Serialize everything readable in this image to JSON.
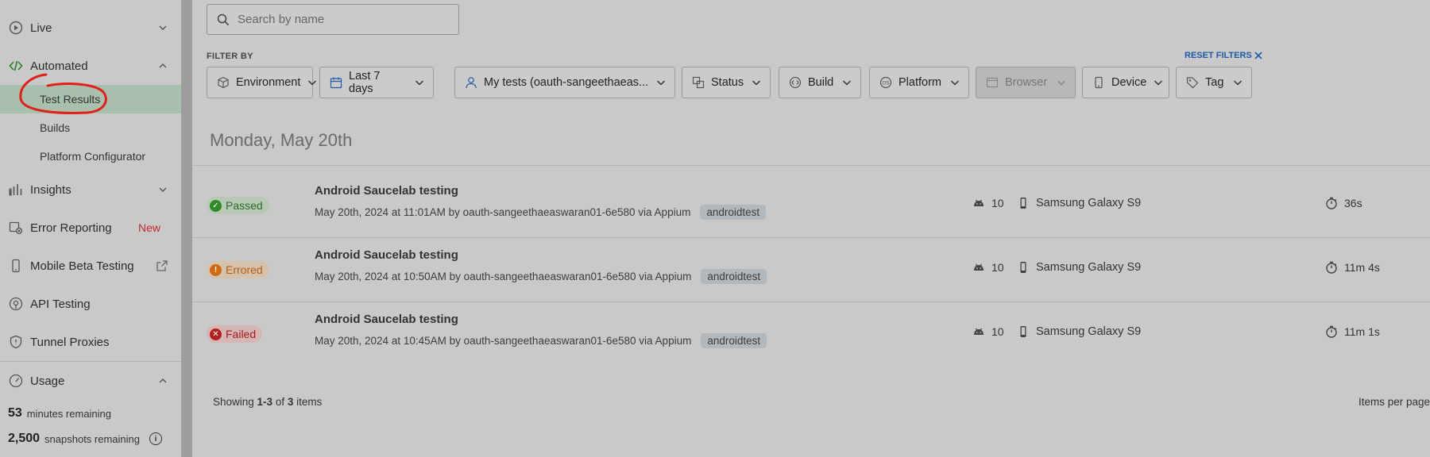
{
  "sidebar": {
    "items": [
      {
        "label": "Live",
        "icon": "play-circle-icon"
      },
      {
        "label": "Automated",
        "icon": "code-icon"
      },
      {
        "label": "Test Results"
      },
      {
        "label": "Builds"
      },
      {
        "label": "Platform Configurator"
      },
      {
        "label": "Insights",
        "icon": "bar-chart-icon"
      },
      {
        "label": "Error Reporting",
        "icon": "bug-icon",
        "badge": "New"
      },
      {
        "label": "Mobile Beta Testing",
        "icon": "mobile-icon"
      },
      {
        "label": "API Testing",
        "icon": "api-icon"
      },
      {
        "label": "Tunnel Proxies",
        "icon": "shield-icon"
      },
      {
        "label": "Usage",
        "icon": "gauge-icon"
      }
    ],
    "usage": {
      "minutes_value": "53",
      "minutes_label": "minutes remaining",
      "snapshots_value": "2,500",
      "snapshots_label": "snapshots remaining"
    }
  },
  "search": {
    "placeholder": "Search by name"
  },
  "filters": {
    "heading": "FILTER BY",
    "reset_label": "RESET FILTERS",
    "items": [
      {
        "label": "Environment",
        "icon": "cube-icon"
      },
      {
        "label": "Last 7 days",
        "icon": "calendar-icon"
      },
      {
        "label": "My tests (oauth-sangeethaeas...",
        "icon": "user-icon"
      },
      {
        "label": "Status",
        "icon": "status-icon"
      },
      {
        "label": "Build",
        "icon": "build-icon"
      },
      {
        "label": "Platform",
        "icon": "os-icon"
      },
      {
        "label": "Browser",
        "icon": "browser-icon",
        "disabled": true
      },
      {
        "label": "Device",
        "icon": "device-icon"
      },
      {
        "label": "Tag",
        "icon": "tag-icon"
      }
    ]
  },
  "results": {
    "date_heading": "Monday, May 20th",
    "rows": [
      {
        "status": "Passed",
        "name": "Android Saucelab testing",
        "meta": "May 20th, 2024 at 11:01AM by oauth-sangeethaeaswaran01-6e580 via Appium",
        "tag": "androidtest",
        "os_version": "10",
        "device": "Samsung Galaxy S9",
        "duration": "36s"
      },
      {
        "status": "Errored",
        "name": "Android Saucelab testing",
        "meta": "May 20th, 2024 at 10:50AM by oauth-sangeethaeaswaran01-6e580 via Appium",
        "tag": "androidtest",
        "os_version": "10",
        "device": "Samsung Galaxy S9",
        "duration": "11m 4s"
      },
      {
        "status": "Failed",
        "name": "Android Saucelab testing",
        "meta": "May 20th, 2024 at 10:45AM by oauth-sangeethaeaswaran01-6e580 via Appium",
        "tag": "androidtest",
        "os_version": "10",
        "device": "Samsung Galaxy S9",
        "duration": "11m 1s"
      }
    ]
  },
  "pagination": {
    "showing_prefix": "Showing ",
    "showing_range": "1-3",
    "showing_of": " of ",
    "showing_total": "3",
    "showing_suffix": " items",
    "items_per_page_label": "Items per page"
  },
  "colors": {
    "accent_green": "#2f8a2a",
    "error_orange": "#cf6a12",
    "failed_red": "#b21f1f",
    "link_blue": "#1f5aa6",
    "annotation_red": "#e0201b"
  }
}
